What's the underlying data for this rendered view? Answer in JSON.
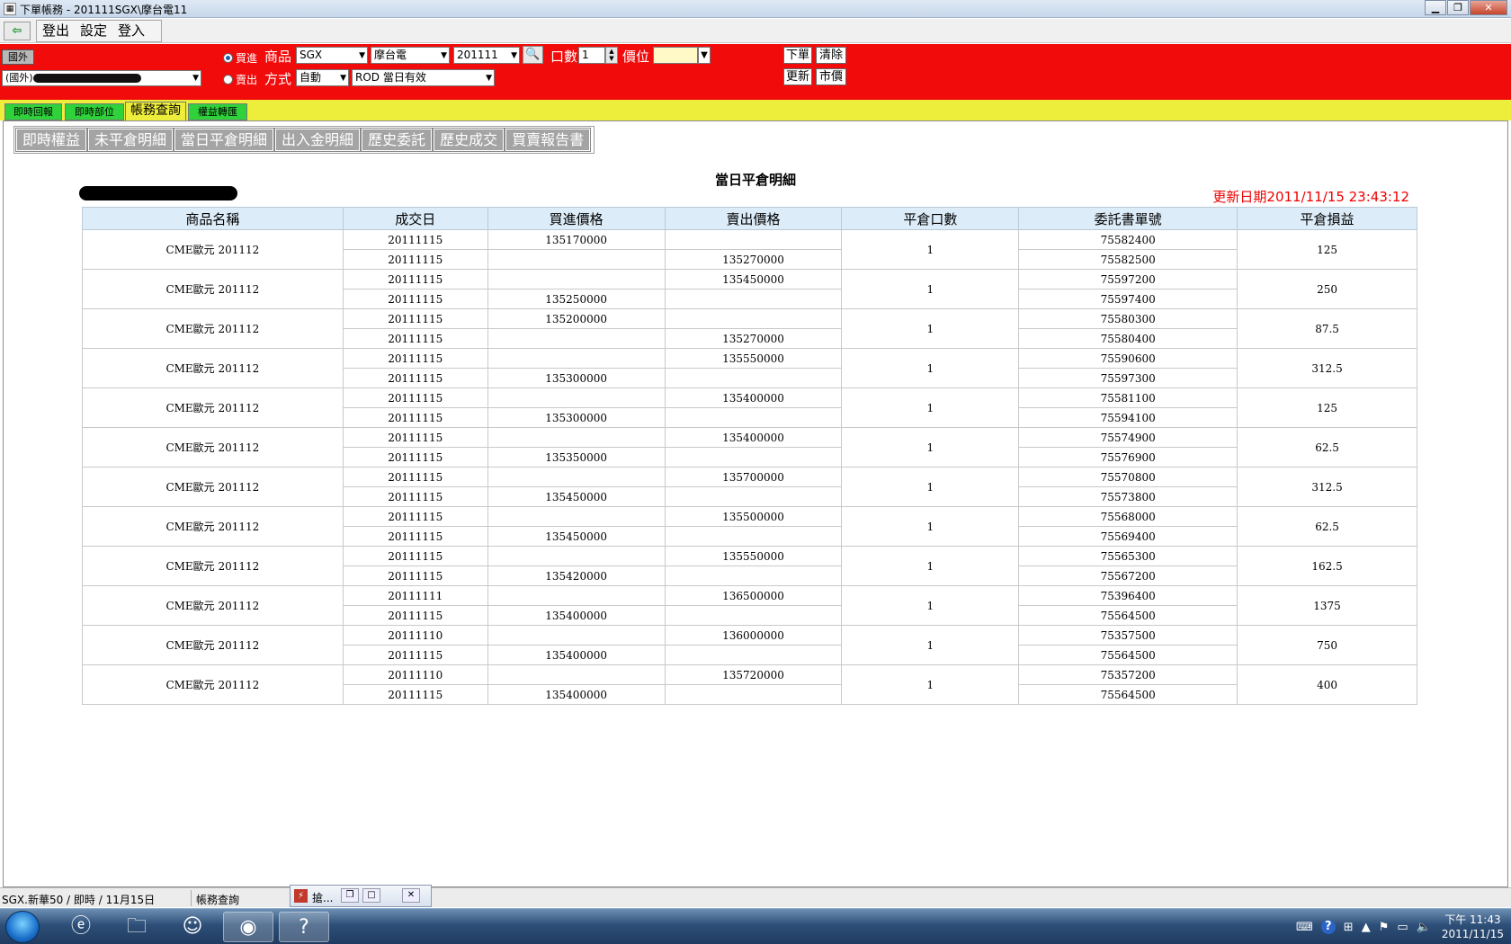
{
  "window": {
    "title": "下單帳務 - 201111SGX\\摩台電11",
    "min": "▁",
    "max": "❐",
    "close": "✕"
  },
  "menubar": {
    "back_icon": "⇦",
    "items": [
      "登出",
      "設定",
      "登入"
    ]
  },
  "order": {
    "market_tag": "國外",
    "account_prefix": "(國外)",
    "buy_label": "買進",
    "sell_label": "賣出",
    "product_label": "商品",
    "method_label": "方式",
    "exchange": "SGX",
    "product": "摩台電",
    "month": "201111",
    "method": "自動",
    "tif": "ROD 當日有效",
    "qty_label": "口數",
    "qty": "1",
    "price_label": "價位",
    "price": "",
    "buttons": {
      "place": "下單",
      "clear": "清除",
      "refresh": "更新",
      "market": "市價"
    }
  },
  "tabs": [
    "即時回報",
    "即時部位",
    "帳務查詢",
    "權益轉匯"
  ],
  "active_tab": "帳務查詢",
  "subnav": [
    "即時權益",
    "未平倉明細",
    "當日平倉明細",
    "出入金明細",
    "歷史委託",
    "歷史成交",
    "買賣報告書"
  ],
  "report": {
    "title": "當日平倉明細",
    "update_label": "更新日期",
    "update_time": "2011/11/15 23:43:12",
    "columns": [
      "商品名稱",
      "成交日",
      "買進價格",
      "賣出價格",
      "平倉口數",
      "委託書單號",
      "平倉損益"
    ],
    "groups": [
      {
        "product": "CME歐元 201112",
        "qty": "1",
        "pnl": "125",
        "rows": [
          {
            "date": "20111115",
            "buy": "135170000",
            "sell": "",
            "order": "75582400"
          },
          {
            "date": "20111115",
            "buy": "",
            "sell": "135270000",
            "order": "75582500"
          }
        ]
      },
      {
        "product": "CME歐元 201112",
        "qty": "1",
        "pnl": "250",
        "rows": [
          {
            "date": "20111115",
            "buy": "",
            "sell": "135450000",
            "order": "75597200"
          },
          {
            "date": "20111115",
            "buy": "135250000",
            "sell": "",
            "order": "75597400"
          }
        ]
      },
      {
        "product": "CME歐元 201112",
        "qty": "1",
        "pnl": "87.5",
        "rows": [
          {
            "date": "20111115",
            "buy": "135200000",
            "sell": "",
            "order": "75580300"
          },
          {
            "date": "20111115",
            "buy": "",
            "sell": "135270000",
            "order": "75580400"
          }
        ]
      },
      {
        "product": "CME歐元 201112",
        "qty": "1",
        "pnl": "312.5",
        "rows": [
          {
            "date": "20111115",
            "buy": "",
            "sell": "135550000",
            "order": "75590600"
          },
          {
            "date": "20111115",
            "buy": "135300000",
            "sell": "",
            "order": "75597300"
          }
        ]
      },
      {
        "product": "CME歐元 201112",
        "qty": "1",
        "pnl": "125",
        "rows": [
          {
            "date": "20111115",
            "buy": "",
            "sell": "135400000",
            "order": "75581100"
          },
          {
            "date": "20111115",
            "buy": "135300000",
            "sell": "",
            "order": "75594100"
          }
        ]
      },
      {
        "product": "CME歐元 201112",
        "qty": "1",
        "pnl": "62.5",
        "rows": [
          {
            "date": "20111115",
            "buy": "",
            "sell": "135400000",
            "order": "75574900"
          },
          {
            "date": "20111115",
            "buy": "135350000",
            "sell": "",
            "order": "75576900"
          }
        ]
      },
      {
        "product": "CME歐元 201112",
        "qty": "1",
        "pnl": "312.5",
        "rows": [
          {
            "date": "20111115",
            "buy": "",
            "sell": "135700000",
            "order": "75570800"
          },
          {
            "date": "20111115",
            "buy": "135450000",
            "sell": "",
            "order": "75573800"
          }
        ]
      },
      {
        "product": "CME歐元 201112",
        "qty": "1",
        "pnl": "62.5",
        "rows": [
          {
            "date": "20111115",
            "buy": "",
            "sell": "135500000",
            "order": "75568000"
          },
          {
            "date": "20111115",
            "buy": "135450000",
            "sell": "",
            "order": "75569400"
          }
        ]
      },
      {
        "product": "CME歐元 201112",
        "qty": "1",
        "pnl": "162.5",
        "rows": [
          {
            "date": "20111115",
            "buy": "",
            "sell": "135550000",
            "order": "75565300"
          },
          {
            "date": "20111115",
            "buy": "135420000",
            "sell": "",
            "order": "75567200"
          }
        ]
      },
      {
        "product": "CME歐元 201112",
        "qty": "1",
        "pnl": "1375",
        "rows": [
          {
            "date": "20111111",
            "buy": "",
            "sell": "136500000",
            "order": "75396400"
          },
          {
            "date": "20111115",
            "buy": "135400000",
            "sell": "",
            "order": "75564500"
          }
        ]
      },
      {
        "product": "CME歐元 201112",
        "qty": "1",
        "pnl": "750",
        "rows": [
          {
            "date": "20111110",
            "buy": "",
            "sell": "136000000",
            "order": "75357500"
          },
          {
            "date": "20111115",
            "buy": "135400000",
            "sell": "",
            "order": "75564500"
          }
        ]
      },
      {
        "product": "CME歐元 201112",
        "qty": "1",
        "pnl": "400",
        "rows": [
          {
            "date": "20111110",
            "buy": "",
            "sell": "135720000",
            "order": "75357200"
          },
          {
            "date": "20111115",
            "buy": "135400000",
            "sell": "",
            "order": "75564500"
          }
        ]
      }
    ]
  },
  "statusbar": {
    "left": "SGX.新華50 / 即時 / 11月15日",
    "mid": "帳務查詢",
    "mini_title": "搶..."
  },
  "taskbar": {
    "time": "下午 11:43",
    "date": "2011/11/15"
  },
  "colors": {
    "order_panel": "#f20b0b",
    "tab_strip": "#eded3c",
    "tab": "#2fd23a",
    "header_cell": "#dcecf8",
    "update_text": "#e00000"
  }
}
